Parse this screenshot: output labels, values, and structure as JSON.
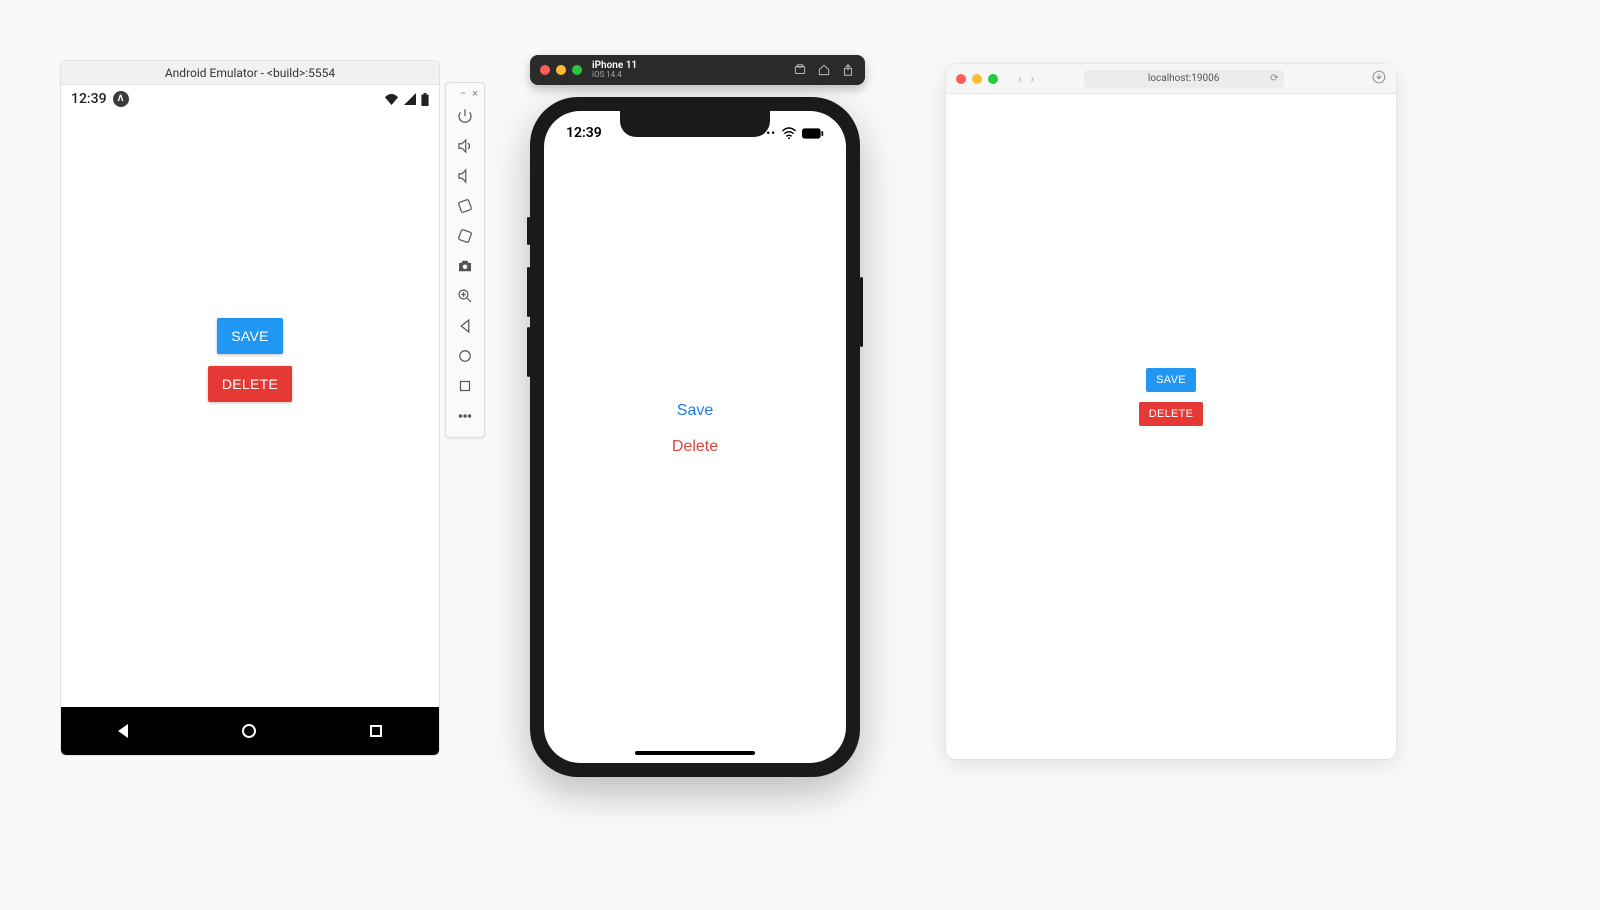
{
  "android": {
    "title": "Android Emulator - <build>:5554",
    "time": "12:39",
    "buttons": {
      "save": "SAVE",
      "delete": "DELETE"
    }
  },
  "androidToolbar": {
    "icons": [
      "power",
      "volume-up",
      "volume-down",
      "rotate-left",
      "rotate-right",
      "camera",
      "zoom",
      "back",
      "home",
      "overview",
      "more"
    ]
  },
  "ios": {
    "titlebar": {
      "device": "iPhone 11",
      "os": "iOS 14.4"
    },
    "time": "12:39",
    "buttons": {
      "save": "Save",
      "delete": "Delete"
    }
  },
  "browser": {
    "url": "localhost:19006",
    "buttons": {
      "save": "SAVE",
      "delete": "DELETE"
    }
  },
  "colors": {
    "blue": "#2196f3",
    "red": "#e53935",
    "iosBlue": "#1f7ae0",
    "iosRed": "#d9463a"
  }
}
